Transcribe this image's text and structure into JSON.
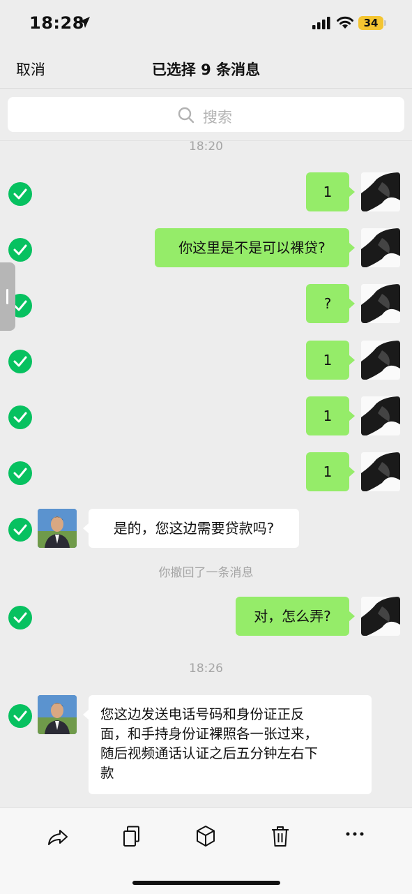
{
  "status_bar": {
    "time": "18:28",
    "battery": "34"
  },
  "nav": {
    "cancel_label": "取消",
    "title": "已选择 9 条消息"
  },
  "search": {
    "placeholder": "搜索"
  },
  "timestamps": {
    "first": "18:20",
    "second": "18:26"
  },
  "system_notice": "你撤回了一条消息",
  "messages": [
    {
      "sender": "me",
      "text": "1",
      "selected": true
    },
    {
      "sender": "me",
      "text": "你这里是不是可以裸贷?",
      "selected": true
    },
    {
      "sender": "me",
      "text": "?",
      "selected": true
    },
    {
      "sender": "me",
      "text": "1",
      "selected": true
    },
    {
      "sender": "me",
      "text": "1",
      "selected": true
    },
    {
      "sender": "me",
      "text": "1",
      "selected": true
    },
    {
      "sender": "other",
      "text": "是的，您这边需要贷款吗?",
      "selected": true
    },
    {
      "sender": "me",
      "text": "对，怎么弄?",
      "selected": true
    },
    {
      "sender": "other",
      "lines": [
        "您这边发送电话号码和身份证正反",
        "面，和手持身份证裸照各一张过来，",
        "随后视频通话认证之后五分钟左右下",
        "款"
      ],
      "selected": true
    }
  ],
  "toolbar": {
    "icons": [
      "share-icon",
      "copy-icon",
      "box-icon",
      "trash-icon",
      "more-icon"
    ]
  },
  "colors": {
    "accent_green": "#07c160",
    "bubble_green": "#95ec69",
    "background": "#ededed"
  }
}
